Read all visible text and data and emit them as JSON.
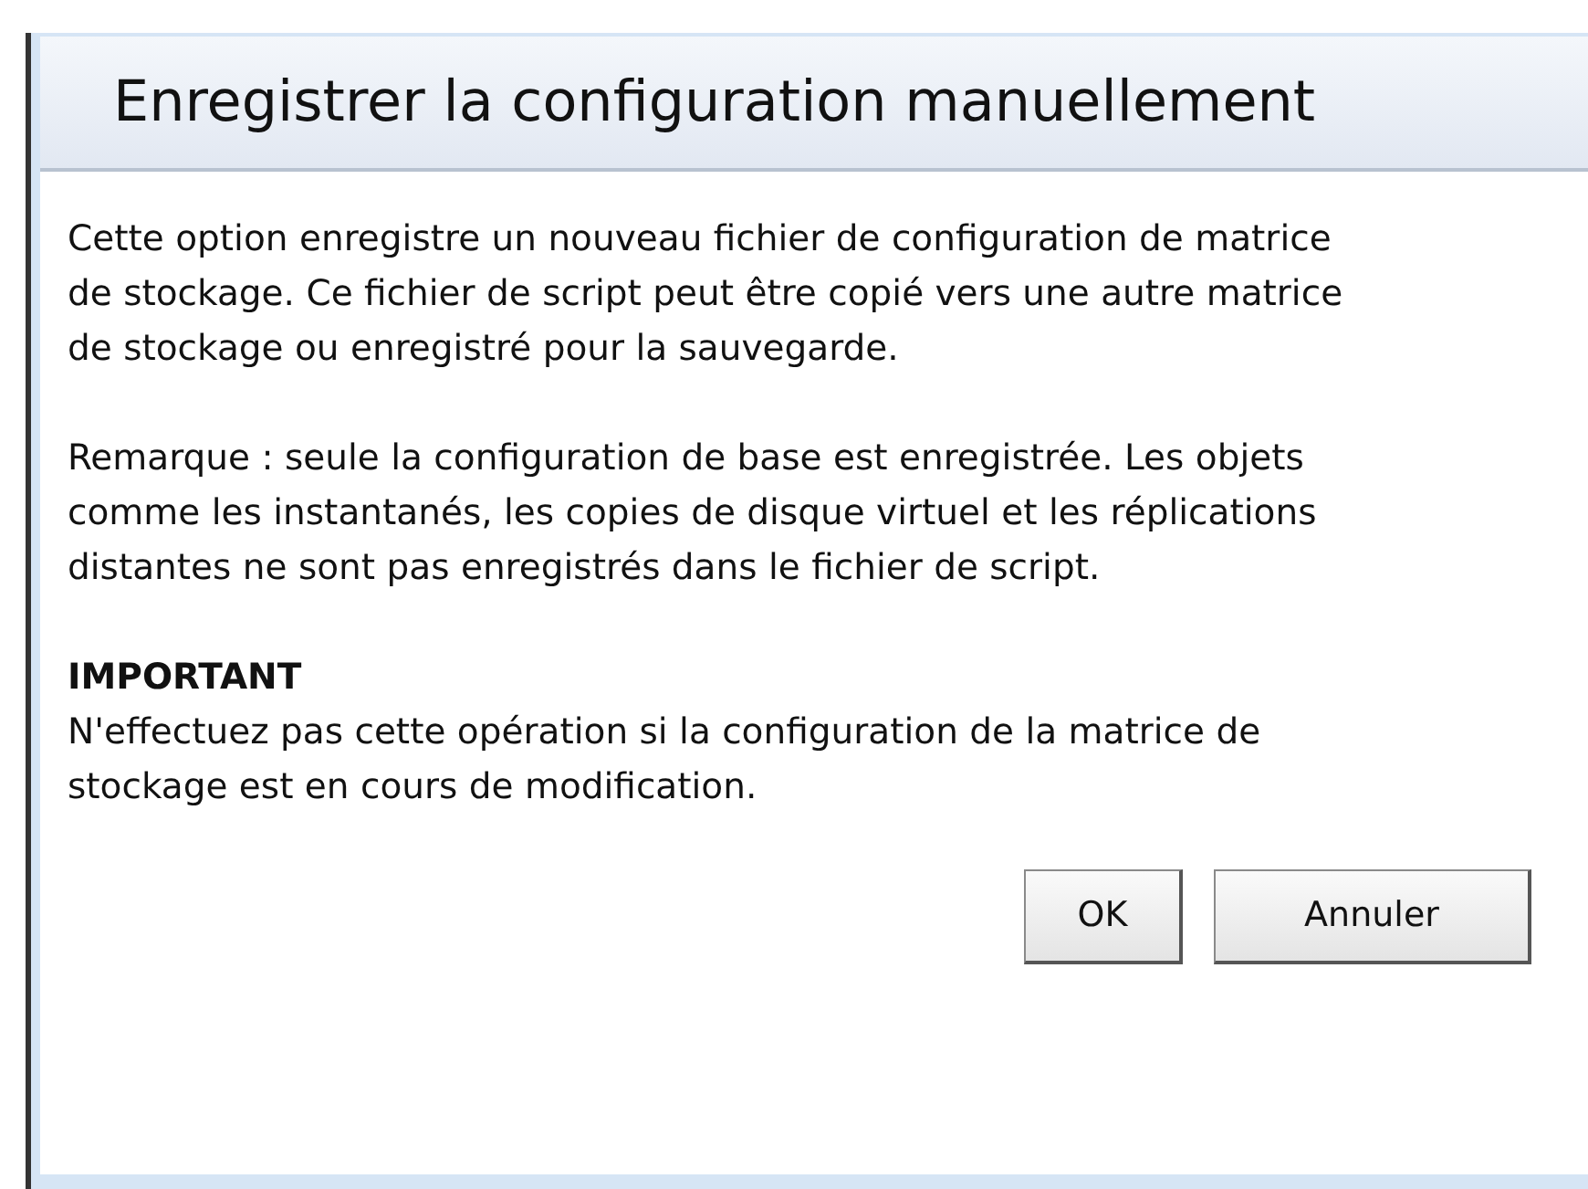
{
  "dialog": {
    "title": "Enregistrer la configuration manuellement",
    "paragraphs": [
      {
        "kind": "text",
        "text": "Cette option enregistre un nouveau fichier de configuration de matrice de stockage. Ce fichier de script peut être copié vers une autre matrice de stockage ou enregistré pour la sauvegarde."
      },
      {
        "kind": "text",
        "text": "Remarque : seule la configuration de base est enregistrée. Les objets comme les instantanés, les copies de disque virtuel et les réplications distantes ne sont pas enregistrés dans le fichier de script."
      },
      {
        "kind": "heading",
        "text": "IMPORTANT"
      },
      {
        "kind": "text",
        "text": "N'effectuez pas cette opération si la configuration de la matrice de stockage est en cours de modification."
      }
    ],
    "buttons": [
      {
        "label": "OK",
        "kind": "narrow"
      },
      {
        "label": "Annuler",
        "kind": "wide"
      }
    ]
  }
}
